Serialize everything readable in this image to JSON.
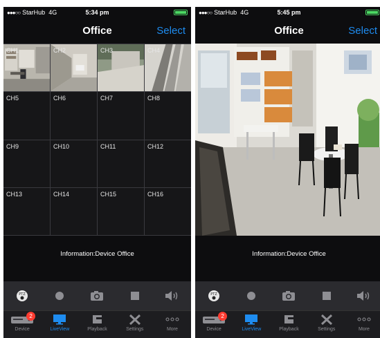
{
  "left": {
    "status": {
      "dots": "●●●○○",
      "carrier": "StarHub",
      "network": "4G",
      "time": "5:34 pm"
    },
    "nav": {
      "title": "Office",
      "select_label": "Select"
    },
    "grid": {
      "channels": [
        "CH1",
        "CH2",
        "CH3",
        "CH4",
        "CH5",
        "CH6",
        "CH7",
        "CH8",
        "CH9",
        "CH10",
        "CH11",
        "CH12",
        "CH13",
        "CH14",
        "CH15",
        "CH16"
      ]
    },
    "info_text": "Information:Device Office",
    "tabs": [
      {
        "label": "Device",
        "badge": "2"
      },
      {
        "label": "LiveView"
      },
      {
        "label": "Playback"
      },
      {
        "label": "Settings"
      },
      {
        "label": "More"
      }
    ]
  },
  "right": {
    "status": {
      "dots": "●●●○○",
      "carrier": "StarHub",
      "network": "4G",
      "time": "5:45 pm"
    },
    "nav": {
      "title": "Office",
      "select_label": "Select"
    },
    "info_text": "Information:Device Office",
    "tabs": [
      {
        "label": "Device",
        "badge": "2"
      },
      {
        "label": "LiveView"
      },
      {
        "label": "Playback"
      },
      {
        "label": "Settings"
      },
      {
        "label": "More"
      }
    ]
  },
  "icons": {
    "toolbar": [
      "ptz-icon",
      "record-icon",
      "snapshot-icon",
      "stop-icon",
      "audio-icon"
    ],
    "tabs": [
      "device-icon",
      "liveview-icon",
      "playback-icon",
      "settings-icon",
      "more-icon"
    ]
  },
  "colors": {
    "accent": "#1e8cf0",
    "active_cell": "#3dbf3d",
    "badge": "#ff3b30",
    "battery": "#4cd964"
  }
}
